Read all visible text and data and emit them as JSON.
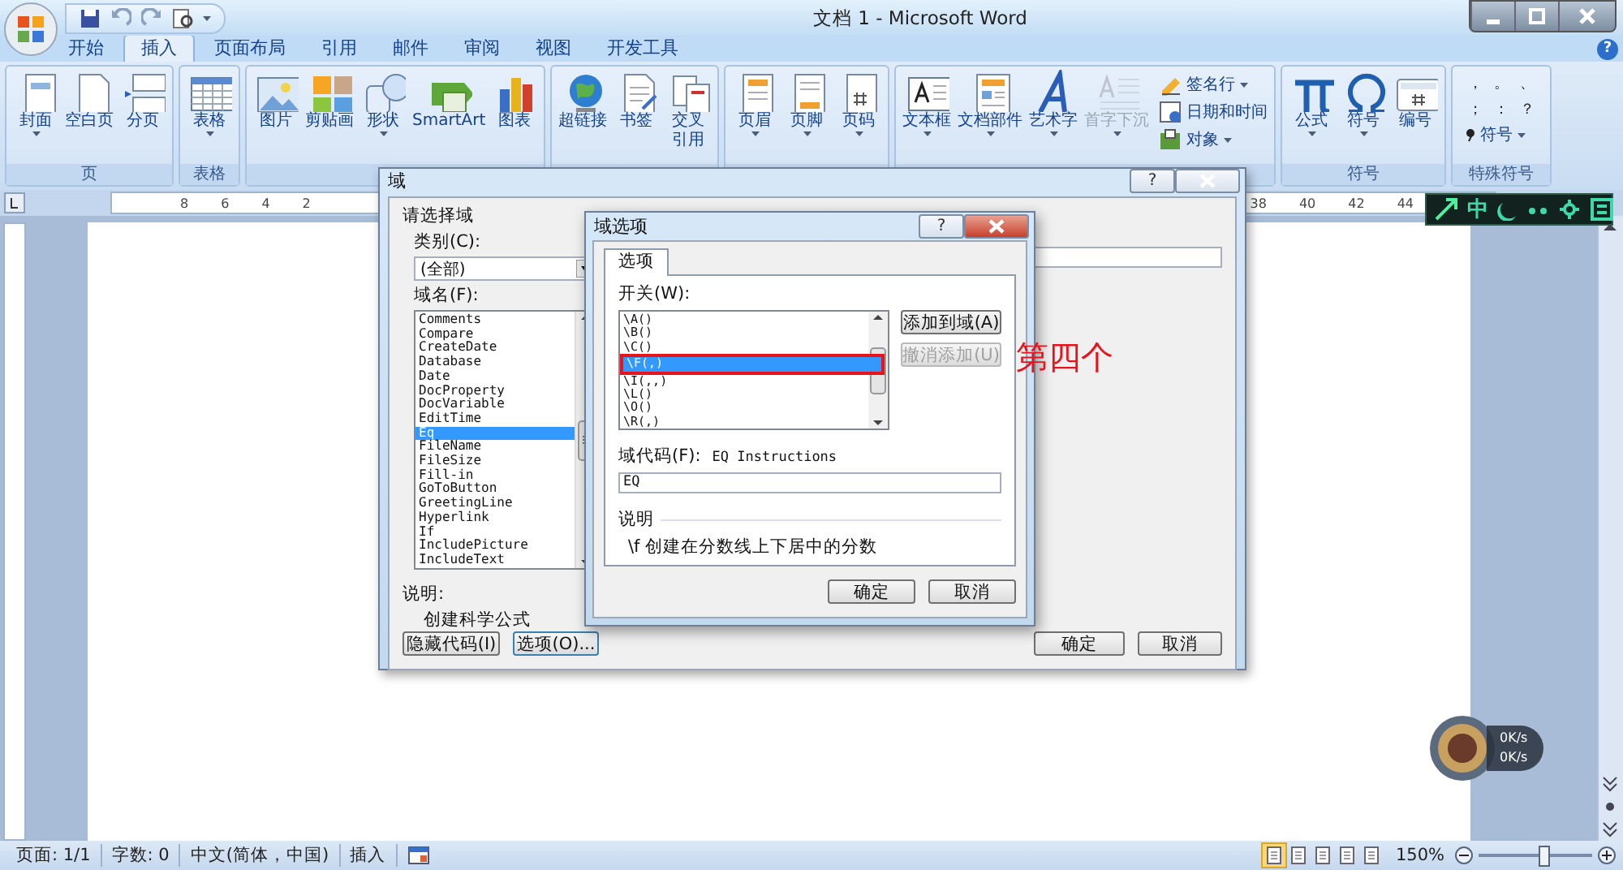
{
  "window": {
    "title": "文档 1 - Microsoft Word",
    "help": "?"
  },
  "tabs": [
    {
      "label": "开始",
      "selected": false
    },
    {
      "label": "插入",
      "selected": true
    },
    {
      "label": "页面布局",
      "selected": false
    },
    {
      "label": "引用",
      "selected": false
    },
    {
      "label": "邮件",
      "selected": false
    },
    {
      "label": "审阅",
      "selected": false
    },
    {
      "label": "视图",
      "selected": false
    },
    {
      "label": "开发工具",
      "selected": false
    }
  ],
  "ribbon": {
    "groups": [
      {
        "label": "页",
        "items": [
          {
            "label": "封面",
            "dropdown": true
          },
          {
            "label": "空白页",
            "dropdown": false
          },
          {
            "label": "分页",
            "dropdown": false
          }
        ]
      },
      {
        "label": "表格",
        "items": [
          {
            "label": "表格",
            "dropdown": true
          }
        ]
      },
      {
        "items": [
          {
            "label": "图片",
            "dropdown": false
          },
          {
            "label": "剪贴画",
            "dropdown": false
          },
          {
            "label": "形状",
            "dropdown": true
          },
          {
            "label": "SmartArt",
            "dropdown": false
          },
          {
            "label": "图表",
            "dropdown": false
          }
        ]
      },
      {
        "items": [
          {
            "label": "超链接",
            "dropdown": false
          },
          {
            "label": "书签",
            "dropdown": false
          },
          {
            "label_lines": [
              "交叉",
              "引用"
            ],
            "dropdown": false
          }
        ]
      },
      {
        "items": [
          {
            "label": "页眉",
            "dropdown": true
          },
          {
            "label": "页脚",
            "dropdown": true
          },
          {
            "label": "页码",
            "dropdown": true
          }
        ]
      },
      {
        "items": [
          {
            "label": "文本框",
            "dropdown": true,
            "disabled": false
          },
          {
            "label": "文档部件",
            "dropdown": true,
            "disabled": false
          },
          {
            "label": "艺术字",
            "dropdown": true,
            "disabled": false
          },
          {
            "label": "首字下沉",
            "dropdown": true,
            "disabled": true
          }
        ],
        "small_items": [
          {
            "label": "签名行",
            "dropdown": true
          },
          {
            "label": "日期和时间",
            "dropdown": false
          },
          {
            "label": "对象",
            "dropdown": true
          }
        ]
      },
      {
        "label": "符号",
        "items": [
          {
            "label": "公式",
            "dropdown": true
          },
          {
            "label": "符号",
            "dropdown": true
          },
          {
            "label": "编号",
            "dropdown": false
          }
        ]
      },
      {
        "label": "特殊符号",
        "symbols": [
          "，",
          "。",
          "、",
          "；",
          "：",
          "？"
        ],
        "small_items": [
          {
            "label": "符号",
            "dropdown": true
          }
        ]
      }
    ]
  },
  "ruler": {
    "left_numbers": [
      "8",
      "6",
      "4",
      "2"
    ],
    "right_numbers": [
      "38",
      "40",
      "42",
      "44"
    ]
  },
  "field_dialog": {
    "title": "域",
    "help": "?",
    "section_title": "请选择域",
    "category_label": "类别(C):",
    "category_value": "(全部)",
    "names_label": "域名(F):",
    "field_names": [
      {
        "label": "Comments",
        "selected": false
      },
      {
        "label": "Compare",
        "selected": false
      },
      {
        "label": "CreateDate",
        "selected": false
      },
      {
        "label": "Database",
        "selected": false
      },
      {
        "label": "Date",
        "selected": false
      },
      {
        "label": "DocProperty",
        "selected": false
      },
      {
        "label": "DocVariable",
        "selected": false
      },
      {
        "label": "EditTime",
        "selected": false
      },
      {
        "label": "Eq",
        "selected": true
      },
      {
        "label": "FileName",
        "selected": false
      },
      {
        "label": "FileSize",
        "selected": false
      },
      {
        "label": "Fill-in",
        "selected": false
      },
      {
        "label": "GoToButton",
        "selected": false
      },
      {
        "label": "GreetingLine",
        "selected": false
      },
      {
        "label": "Hyperlink",
        "selected": false
      },
      {
        "label": "If",
        "selected": false
      },
      {
        "label": "IncludePicture",
        "selected": false
      },
      {
        "label": "IncludeText",
        "selected": false
      }
    ],
    "description_label": "说明:",
    "description": "创建科学公式",
    "hide_codes_button": "隐藏代码(I)",
    "options_button": "选项(O)...",
    "ok": "确定",
    "cancel": "取消"
  },
  "options_dialog": {
    "title": "域选项",
    "help": "?",
    "tabs": [
      {
        "label": "选项",
        "selected": true
      }
    ],
    "switches_label": "开关(W):",
    "switches": [
      {
        "label": "\\A()",
        "selected": false,
        "boxed": false
      },
      {
        "label": "\\B()",
        "selected": false,
        "boxed": false
      },
      {
        "label": "\\C()",
        "selected": false,
        "boxed": false
      },
      {
        "label": "\\F(,)",
        "selected": true,
        "boxed": true
      },
      {
        "label": "\\I(,,)",
        "selected": false,
        "boxed": false
      },
      {
        "label": "\\L()",
        "selected": false,
        "boxed": false
      },
      {
        "label": "\\O()",
        "selected": false,
        "boxed": false
      },
      {
        "label": "\\R(,)",
        "selected": false,
        "boxed": false
      }
    ],
    "add_button": {
      "label": "添加到域(A)",
      "disabled": false
    },
    "undo_button": {
      "label": "撤消添加(U)",
      "disabled": true
    },
    "code_label": "域代码(F):",
    "code_hint": "EQ Instructions",
    "code_value": "EQ",
    "description_label": "说明",
    "description": "\\f 创建在分数线上下居中的分数",
    "ok": "确定",
    "cancel": "取消"
  },
  "annotation": {
    "text": "第四个"
  },
  "ime": {
    "mode": "中"
  },
  "speed_widget": {
    "readings": [
      "0K/s",
      "0K/s"
    ]
  },
  "status_bar": {
    "items": [
      "页面: 1/1",
      "字数: 0",
      "中文(简体，中国)",
      "插入"
    ],
    "views": [
      {
        "selected": true
      },
      {
        "selected": false
      },
      {
        "selected": false
      },
      {
        "selected": false
      },
      {
        "selected": false
      }
    ],
    "zoom": "150%",
    "zoom_slider": {
      "level": 0.55
    }
  }
}
